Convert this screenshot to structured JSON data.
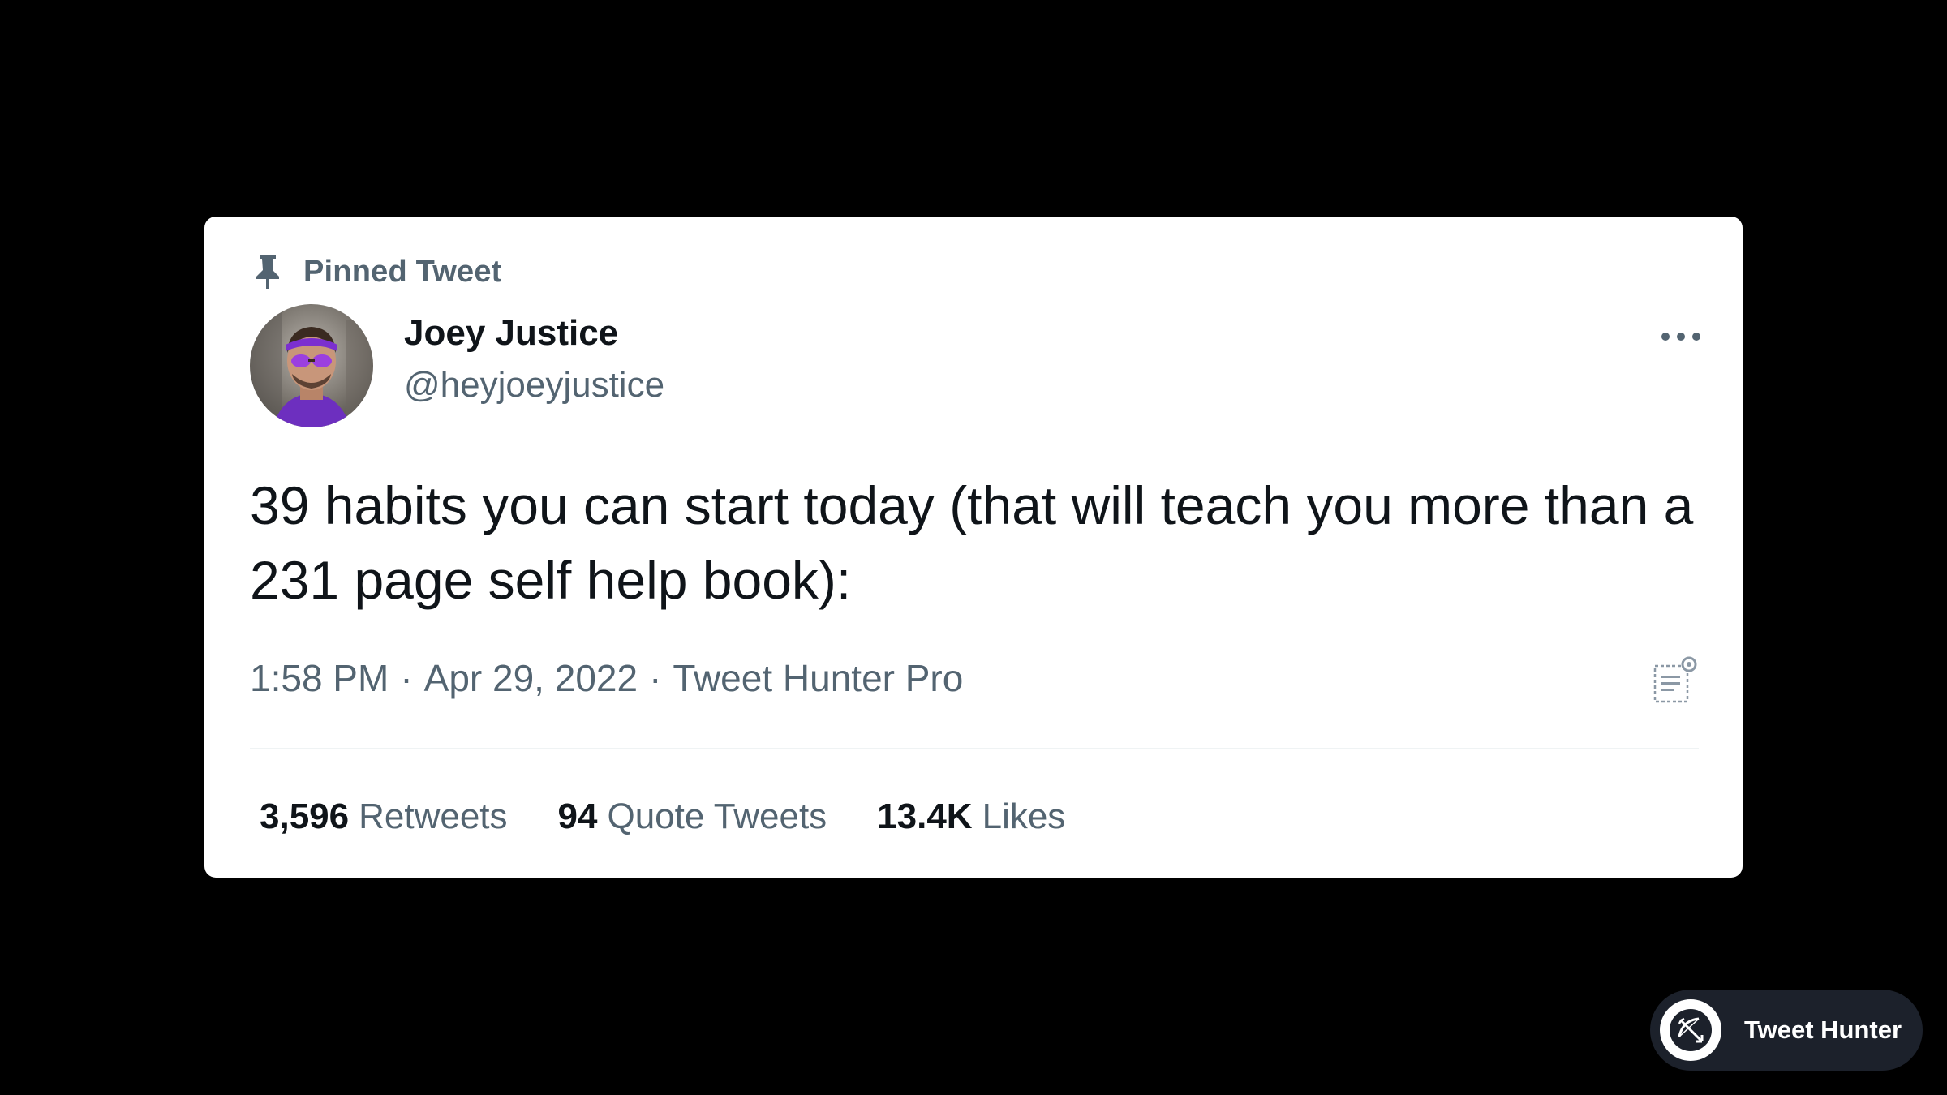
{
  "tweet": {
    "pinned_label": "Pinned Tweet",
    "author": {
      "name": "Joey Justice",
      "handle": "@heyjoeyjustice"
    },
    "text": "39 habits you can start today (that will teach you more than a 231 page self help book):",
    "meta": {
      "time": "1:58 PM",
      "separator": "·",
      "date": "Apr 29, 2022",
      "source": "Tweet Hunter Pro"
    },
    "stats": [
      {
        "count": "3,596",
        "label": "Retweets"
      },
      {
        "count": "94",
        "label": "Quote Tweets"
      },
      {
        "count": "13.4K",
        "label": "Likes"
      }
    ]
  },
  "branding": {
    "name": "Tweet Hunter"
  },
  "icons": {
    "pin": "pin-icon",
    "more": "more-horizontal-icon",
    "analytics": "analytics-icon",
    "brand": "bow-arrow-icon"
  },
  "colors": {
    "background": "#000000",
    "card": "#ffffff",
    "primary_text": "#0f1419",
    "secondary_text": "#536471",
    "avatar_accent": "#7b2fd0",
    "brand_pill": "#1c212b"
  }
}
